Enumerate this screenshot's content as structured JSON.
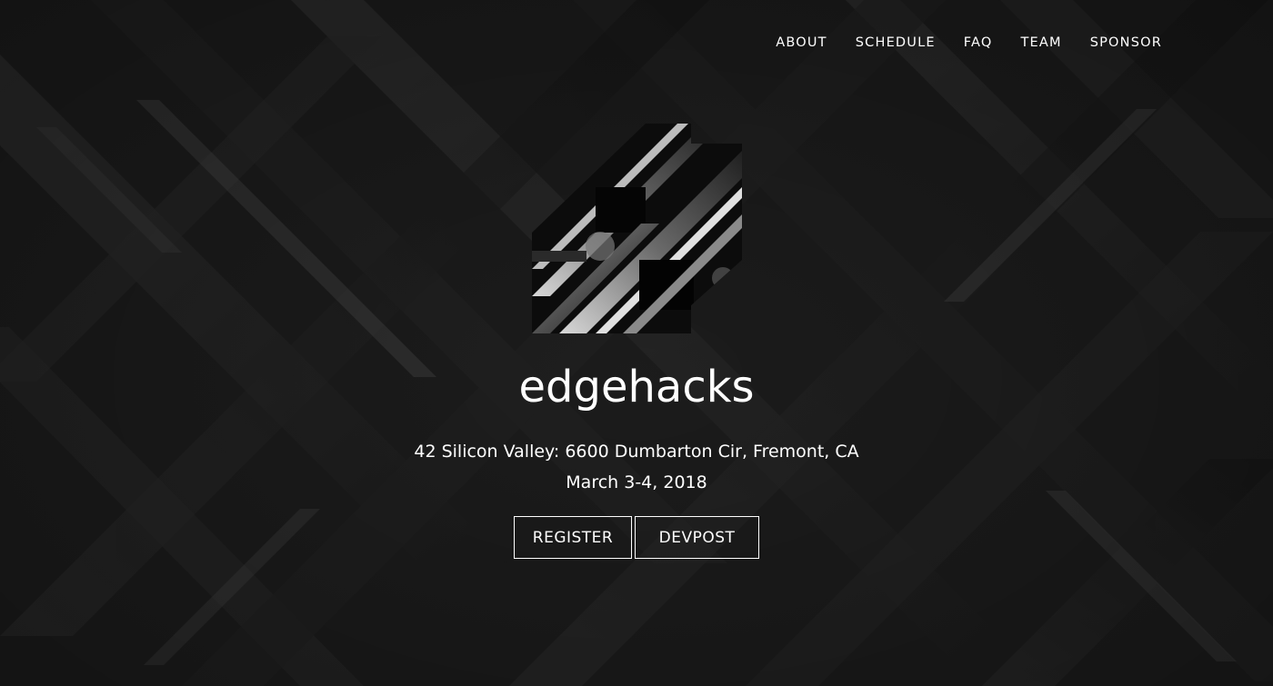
{
  "nav": {
    "items": [
      {
        "label": "ABOUT"
      },
      {
        "label": "SCHEDULE"
      },
      {
        "label": "FAQ"
      },
      {
        "label": "TEAM"
      },
      {
        "label": "SPONSOR"
      }
    ]
  },
  "hero": {
    "logo_icon": "edgehacks-logo-icon",
    "title": "edgehacks",
    "address": "42 Silicon Valley: 6600 Dumbarton Cir, Fremont, CA",
    "date": "March 3-4, 2018",
    "buttons": {
      "register_label": "REGISTER",
      "devpost_label": "DEVPOST"
    }
  },
  "colors": {
    "background": "#1d1d1d",
    "text": "#ffffff",
    "stripe_light": "#3a3a3a",
    "stripe_dark": "#121212"
  }
}
